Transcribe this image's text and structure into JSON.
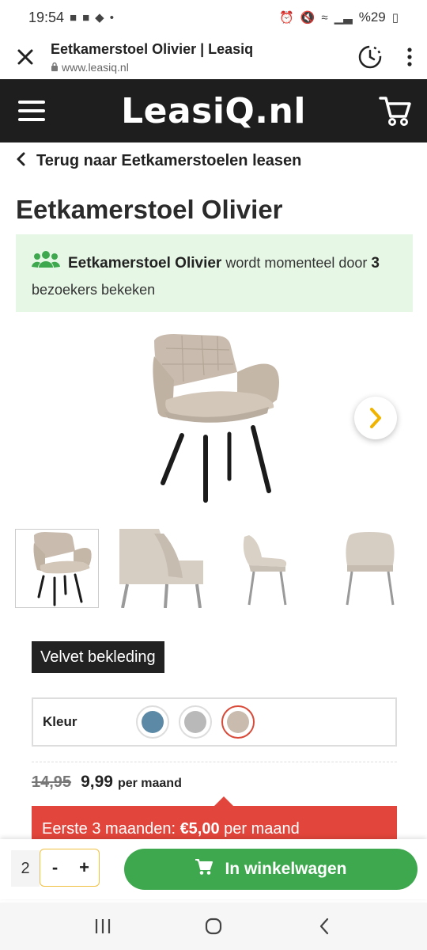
{
  "status": {
    "time": "19:54",
    "battery": "%29"
  },
  "browser": {
    "tab_title": "Eetkamerstoel Olivier | Leasiq",
    "url": "www.leasiq.nl"
  },
  "site": {
    "logo": "LeasiQ.nl"
  },
  "nav": {
    "back_label": "Terug naar Eetkamerstoelen leasen"
  },
  "product": {
    "title": "Eetkamerstoel Olivier",
    "notice_name": "Eetkamerstoel Olivier",
    "notice_text": " wordt momenteel door ",
    "notice_count": "3",
    "notice_suffix": " bezoekers bekeken",
    "badge": "Velvet bekleding",
    "color_label": "Kleur",
    "colors": [
      "#5b89a6",
      "#b9b9b9",
      "#c9bcae"
    ],
    "selected_color_index": 2,
    "old_price": "14,95",
    "new_price": "9,99",
    "per_month": "per maand",
    "promo_prefix": "Eerste 3 maanden: ",
    "promo_amount": "€5,00",
    "promo_suffix": " per maand"
  },
  "cart": {
    "quantity": "2",
    "minus": "-",
    "plus": "+",
    "cta_label": "In winkelwagen"
  },
  "icons": {
    "close": "close-icon",
    "lock": "lock-icon",
    "timer": "timer-icon",
    "overflow": "more-vertical-icon",
    "hamburger": "hamburger-menu-icon",
    "cart": "shopping-cart-icon",
    "back": "chevron-left-icon",
    "people": "people-icon",
    "next": "chevron-right-icon"
  },
  "colors": {
    "header_bg": "#1e1e1e",
    "notice_bg": "#e6f7e6",
    "promo_bg": "#e2453b",
    "cta_bg": "#3ea84e",
    "accent_yellow": "#f0b400"
  }
}
